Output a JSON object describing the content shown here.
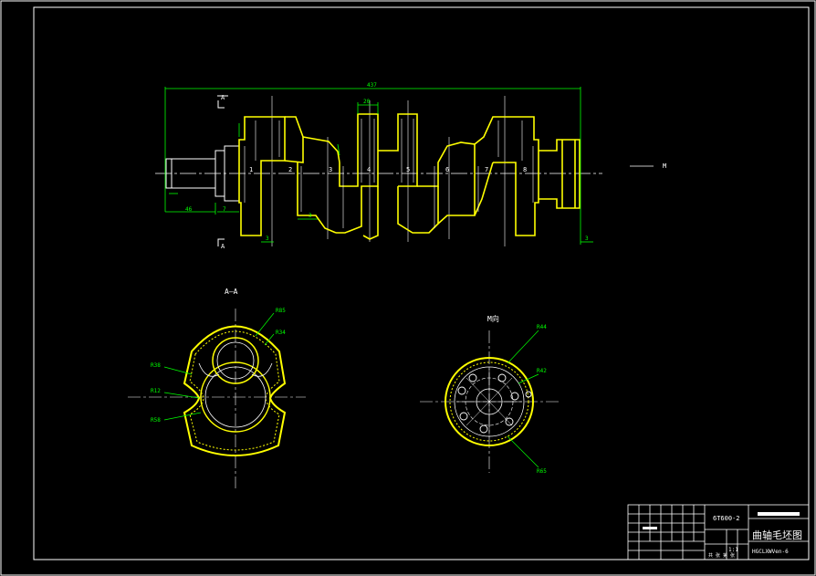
{
  "colors": {
    "background": "#000000",
    "outline": "#ffffff",
    "part": "#ffff00",
    "dimension": "#00ff00",
    "hatch": "#ffff00"
  },
  "labels": {
    "overall_length": "437",
    "web_width": "20",
    "left_length": "46",
    "chamfer_7": "7",
    "dim_3a": "3",
    "dim_3b": "3",
    "dim_3c": "3",
    "section_arrow_top": "A",
    "section_arrow_bottom": "A",
    "view_arrow": "M",
    "journals": [
      "1",
      "2",
      "3",
      "4",
      "5",
      "6",
      "7",
      "8"
    ]
  },
  "section_view": {
    "title": "A—A",
    "radii": [
      "R85",
      "R34",
      "R38",
      "R12",
      "R58"
    ]
  },
  "flange_view": {
    "title": "M向",
    "radii": [
      "R44",
      "R42",
      "R65"
    ]
  },
  "title_block": {
    "drawing_number": "6T600-2",
    "drawing_title": "曲轴毛坯图",
    "material": "HGCLXWVen-6",
    "scale": "1:1",
    "sheet": "共 张 第 张"
  }
}
